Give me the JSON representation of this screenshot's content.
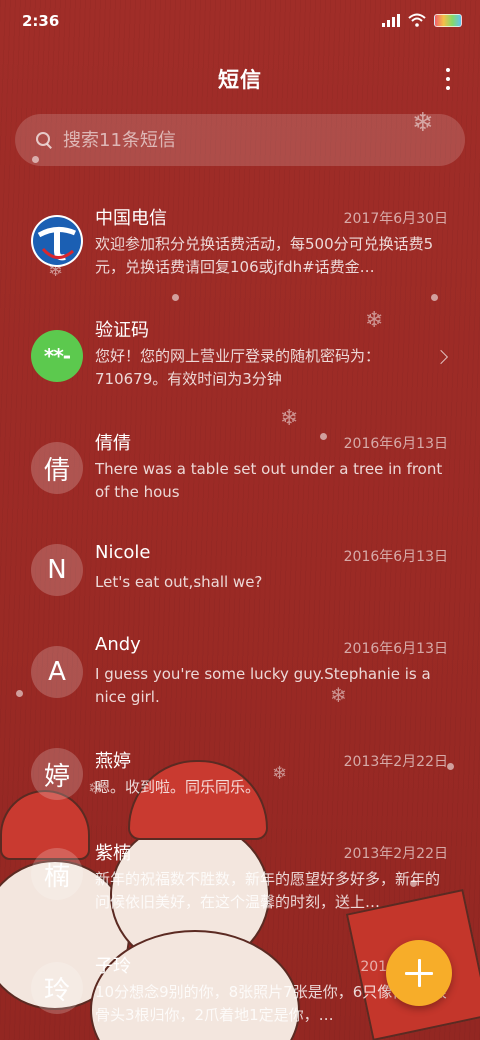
{
  "status_bar": {
    "time": "2:36"
  },
  "header": {
    "title": "短信"
  },
  "search": {
    "placeholder": "搜索11条短信"
  },
  "messages": [
    {
      "sender": "中国电信",
      "date": "2017年6月30日",
      "preview": "欢迎参加积分兑换话费活动，每500分可兑换话费5元，兑换话费请回复106或jfdh#话费金…",
      "avatar_icon": "china-telecom-logo"
    },
    {
      "sender": "验证码",
      "preview": "您好！您的网上营业厅登录的随机密码为：710679。有效时间为3分钟",
      "avatar_text": "**-"
    },
    {
      "sender": "倩倩",
      "date": "2016年6月13日",
      "preview": "There was a table set out under a tree in front of the hous",
      "avatar_text": "倩"
    },
    {
      "sender": "Nicole",
      "date": "2016年6月13日",
      "preview": "Let's eat out,shall we?",
      "avatar_text": "N"
    },
    {
      "sender": "Andy",
      "date": "2016年6月13日",
      "preview": "I guess you're some lucky guy.Stephanie is a nice girl.",
      "avatar_text": "A"
    },
    {
      "sender": "燕婷",
      "date": "2013年2月22日",
      "preview": "嗯。收到啦。同乐同乐。",
      "avatar_text": "婷"
    },
    {
      "sender": "紫楠",
      "date": "2013年2月22日",
      "preview": "新年的祝福数不胜数，新年的愿望好多好多，新年的问候依旧美好，在这个温馨的时刻，送上…",
      "avatar_text": "楠"
    },
    {
      "sender": "子玲",
      "date": "2013年",
      "preview": "10分想念9别的你，8张照片7张是你，6只像你，4根骨头3根归你，2爪着地1定是你，…",
      "avatar_text": "玲"
    }
  ],
  "colors": {
    "background": "#9e2b26",
    "fab": "#f7ad29",
    "code_avatar": "#5cc94e"
  }
}
